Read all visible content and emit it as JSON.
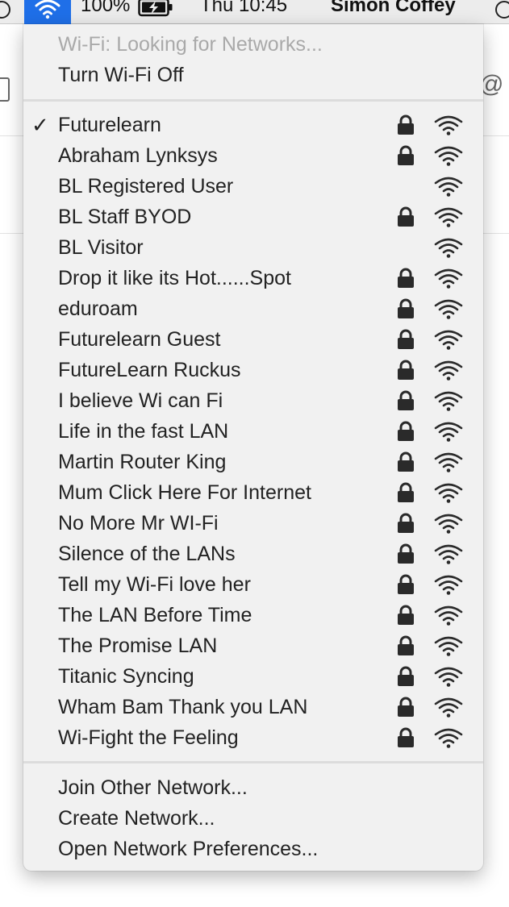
{
  "menubar": {
    "battery_percent": "100%",
    "clock": "Thu 10:45",
    "user_name": "Simon Coffey"
  },
  "wifi_menu": {
    "status": "Wi-Fi: Looking for Networks...",
    "toggle_label": "Turn Wi-Fi Off",
    "networks": [
      {
        "name": "Futurelearn",
        "connected": true,
        "secured": true
      },
      {
        "name": "Abraham Lynksys",
        "connected": false,
        "secured": true
      },
      {
        "name": "BL Registered User",
        "connected": false,
        "secured": false
      },
      {
        "name": "BL Staff BYOD",
        "connected": false,
        "secured": true
      },
      {
        "name": "BL Visitor",
        "connected": false,
        "secured": false
      },
      {
        "name": "Drop it like its Hot......Spot",
        "connected": false,
        "secured": true
      },
      {
        "name": "eduroam",
        "connected": false,
        "secured": true
      },
      {
        "name": "Futurelearn Guest",
        "connected": false,
        "secured": true
      },
      {
        "name": "FutureLearn Ruckus",
        "connected": false,
        "secured": true
      },
      {
        "name": "I believe Wi can Fi",
        "connected": false,
        "secured": true
      },
      {
        "name": "Life in the fast LAN",
        "connected": false,
        "secured": true
      },
      {
        "name": "Martin Router King",
        "connected": false,
        "secured": true
      },
      {
        "name": "Mum Click Here For Internet",
        "connected": false,
        "secured": true
      },
      {
        "name": "No More Mr WI-Fi",
        "connected": false,
        "secured": true
      },
      {
        "name": "Silence of the LANs",
        "connected": false,
        "secured": true
      },
      {
        "name": "Tell my Wi-Fi love her",
        "connected": false,
        "secured": true
      },
      {
        "name": "The LAN Before Time",
        "connected": false,
        "secured": true
      },
      {
        "name": "The Promise LAN",
        "connected": false,
        "secured": true
      },
      {
        "name": "Titanic Syncing",
        "connected": false,
        "secured": true
      },
      {
        "name": "Wham Bam Thank you LAN",
        "connected": false,
        "secured": true
      },
      {
        "name": "Wi-Fight the Feeling",
        "connected": false,
        "secured": true
      }
    ],
    "actions": {
      "join_other": "Join Other Network...",
      "create": "Create Network...",
      "preferences": "Open Network Preferences..."
    },
    "checkmark": "✓"
  },
  "colors": {
    "accent": "#1f6fe8",
    "menu_background": "#f1f1f1",
    "disabled_text": "#a9a9a9"
  },
  "icons": {
    "menubar_wifi": "wifi-icon",
    "battery": "battery-charging-icon",
    "network_lock": "lock-icon",
    "network_signal": "wifi-signal-icon"
  }
}
